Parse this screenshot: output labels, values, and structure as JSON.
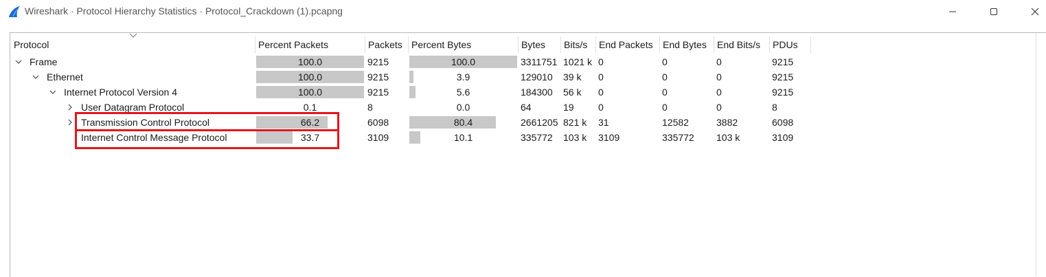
{
  "window": {
    "title": "Wireshark · Protocol Hierarchy Statistics · Protocol_Crackdown (1).pcapng",
    "accent_color": "#1a6bd1"
  },
  "columns": [
    "Protocol",
    "Percent Packets",
    "Packets",
    "Percent Bytes",
    "Bytes",
    "Bits/s",
    "End Packets",
    "End Bytes",
    "End Bits/s",
    "PDUs"
  ],
  "rows": [
    {
      "protocol": "Frame",
      "pct_packets": "100.0",
      "packets": "9215",
      "pct_bytes": "100.0",
      "bytes": "3311751",
      "bits": "1021 k",
      "end_packets": "0",
      "end_bytes": "0",
      "end_bits": "0",
      "pdus": "9215",
      "expander": "expanded",
      "pct_packets_value": 100.0,
      "pct_bytes_value": 100.0
    },
    {
      "protocol": "Ethernet",
      "pct_packets": "100.0",
      "packets": "9215",
      "pct_bytes": "3.9",
      "bytes": "129010",
      "bits": "39 k",
      "end_packets": "0",
      "end_bytes": "0",
      "end_bits": "0",
      "pdus": "9215",
      "expander": "expanded",
      "pct_packets_value": 100.0,
      "pct_bytes_value": 3.9
    },
    {
      "protocol": "Internet Protocol Version 4",
      "pct_packets": "100.0",
      "packets": "9215",
      "pct_bytes": "5.6",
      "bytes": "184300",
      "bits": "56 k",
      "end_packets": "0",
      "end_bytes": "0",
      "end_bits": "0",
      "pdus": "9215",
      "expander": "expanded",
      "pct_packets_value": 100.0,
      "pct_bytes_value": 5.6
    },
    {
      "protocol": "User Datagram Protocol",
      "pct_packets": "0.1",
      "packets": "8",
      "pct_bytes": "0.0",
      "bytes": "64",
      "bits": "19",
      "end_packets": "0",
      "end_bytes": "0",
      "end_bits": "0",
      "pdus": "8",
      "expander": "collapsed",
      "pct_packets_value": 0.1,
      "pct_bytes_value": 0.0
    },
    {
      "protocol": "Transmission Control Protocol",
      "pct_packets": "66.2",
      "packets": "6098",
      "pct_bytes": "80.4",
      "bytes": "2661205",
      "bits": "821 k",
      "end_packets": "31",
      "end_bytes": "12582",
      "end_bits": "3882",
      "pdus": "6098",
      "expander": "collapsed",
      "pct_packets_value": 66.2,
      "pct_bytes_value": 80.4
    },
    {
      "protocol": "Internet Control Message Protocol",
      "pct_packets": "33.7",
      "packets": "3109",
      "pct_bytes": "10.1",
      "bytes": "335772",
      "bits": "103 k",
      "end_packets": "3109",
      "end_bytes": "335772",
      "end_bits": "103 k",
      "pdus": "3109",
      "expander": "none",
      "pct_packets_value": 33.7,
      "pct_bytes_value": 10.1
    }
  ],
  "highlight_color": "#e8141b"
}
